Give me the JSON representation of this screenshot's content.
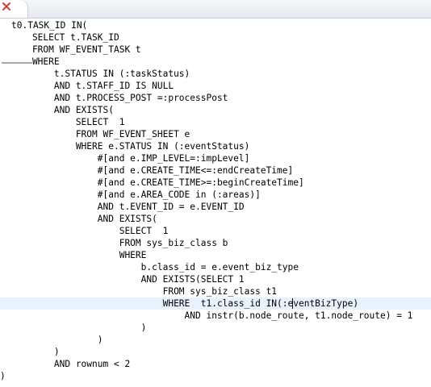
{
  "editor": {
    "lines": [
      "t0.TASK_ID IN(",
      "    SELECT t.TASK_ID",
      "    FROM WF_EVENT_TASK t",
      "    WHERE",
      "        t.STATUS IN (:taskStatus)",
      "        AND t.STAFF_ID IS NULL",
      "        AND t.PROCESS_POST =:processPost",
      "        AND EXISTS(",
      "            SELECT  1",
      "            FROM WF_EVENT_SHEET e",
      "            WHERE e.STATUS IN (:eventStatus)",
      "                #[and e.IMP_LEVEL=:impLevel]",
      "                #[and e.CREATE_TIME<=:endCreateTime]",
      "                #[and e.CREATE_TIME>=:beginCreateTime]",
      "                #[and e.AREA_CODE in (:areas)]",
      "                AND t.EVENT_ID = e.EVENT_ID",
      "                AND EXISTS(",
      "                    SELECT  1",
      "                    FROM sys_biz_class b",
      "                    WHERE",
      "                        b.class_id = e.event_biz_type",
      "                        AND EXISTS(SELECT 1",
      "                            FROM sys_biz_class t1",
      "                            WHERE  t1.class_id IN(:eventBizType)",
      "                                AND instr(b.node_route, t1.node_route) = 1",
      "                        )",
      "                )",
      "        )",
      "        AND rownum < 2",
      ")"
    ]
  }
}
